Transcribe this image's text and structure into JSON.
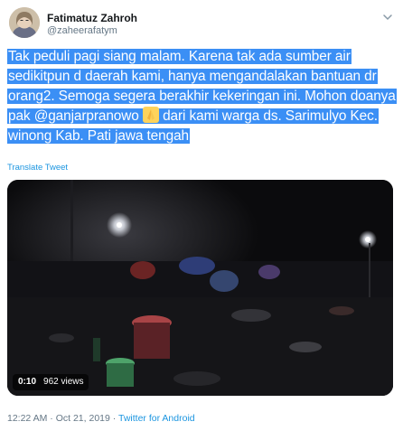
{
  "user": {
    "name": "Fatimatuz Zahroh",
    "handle": "@zaheerafatym"
  },
  "tweet": {
    "text_part1": "Tak peduli pagi siang malam. Karena tak ada sumber air sedikitpun d daerah kami, hanya mengandalakan bantuan dr orang2. Semoga segera berakhir kekeringan ini. Mohon doanya pak @ganjarpranowo ",
    "emoji": "folded-hands-emoji",
    "text_part2": " dari kami warga ds. Sarimulyo Kec. winong Kab. Pati jawa tengah",
    "translate_label": "Translate Tweet"
  },
  "video": {
    "duration": "0:10",
    "views": "962 views"
  },
  "footer": {
    "time": "12:22 AM",
    "separator": " · ",
    "date": "Oct 21, 2019",
    "separator2": " · ",
    "source": "Twitter for Android"
  },
  "colors": {
    "highlight": "#3b8ff5",
    "link": "#1b95e0",
    "muted": "#657786"
  }
}
